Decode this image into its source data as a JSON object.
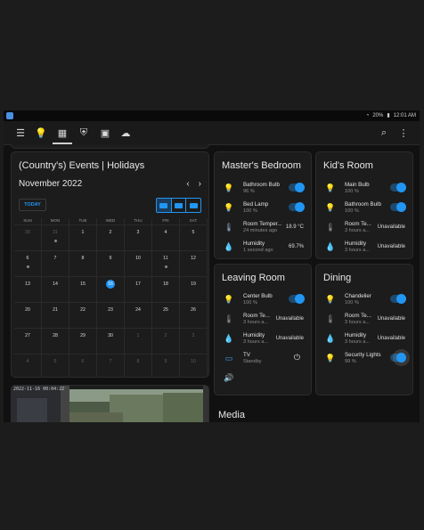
{
  "status_bar": {
    "battery": "20%",
    "time": "12:01 AM"
  },
  "toolbar": {
    "icons": [
      "menu-icon",
      "bulb-icon",
      "dashboard-icon",
      "shield-icon",
      "device-icon",
      "cloud-icon",
      "search-icon",
      "more-icon"
    ]
  },
  "calendar": {
    "title": "(Country's) Events | Holidays",
    "month": "November 2022",
    "today_label": "TODAY",
    "dow": [
      "SUN",
      "MON",
      "TUE",
      "WED",
      "THU",
      "FRI",
      "SAT"
    ],
    "weeks": [
      [
        {
          "d": "30",
          "o": true
        },
        {
          "d": "31",
          "o": true,
          "dot": true
        },
        {
          "d": "1"
        },
        {
          "d": "2"
        },
        {
          "d": "3"
        },
        {
          "d": "4"
        },
        {
          "d": "5"
        }
      ],
      [
        {
          "d": "6",
          "dot": true
        },
        {
          "d": "7"
        },
        {
          "d": "8"
        },
        {
          "d": "9"
        },
        {
          "d": "10"
        },
        {
          "d": "11",
          "dot": true
        },
        {
          "d": "12"
        }
      ],
      [
        {
          "d": "13"
        },
        {
          "d": "14"
        },
        {
          "d": "15"
        },
        {
          "d": "16",
          "today": true
        },
        {
          "d": "17"
        },
        {
          "d": "18"
        },
        {
          "d": "19"
        }
      ],
      [
        {
          "d": "20"
        },
        {
          "d": "21"
        },
        {
          "d": "22"
        },
        {
          "d": "23"
        },
        {
          "d": "24"
        },
        {
          "d": "25"
        },
        {
          "d": "26"
        }
      ],
      [
        {
          "d": "27"
        },
        {
          "d": "28"
        },
        {
          "d": "29"
        },
        {
          "d": "30"
        },
        {
          "d": "1",
          "o": true
        },
        {
          "d": "2",
          "o": true
        },
        {
          "d": "3",
          "o": true
        }
      ],
      [
        {
          "d": "4",
          "o": true
        },
        {
          "d": "5",
          "o": true
        },
        {
          "d": "6",
          "o": true
        },
        {
          "d": "7",
          "o": true
        },
        {
          "d": "8",
          "o": true
        },
        {
          "d": "9",
          "o": true
        },
        {
          "d": "10",
          "o": true
        }
      ]
    ]
  },
  "camera": {
    "timestamp": "2022-11-16 00:04:22"
  },
  "master_bedroom": {
    "title": "Master's Bedroom",
    "rows": [
      {
        "name": "Bathroom Bulb",
        "sub": "96 %"
      },
      {
        "name": "Bed Lamp",
        "sub": "100 %"
      },
      {
        "name": "Room Temper...",
        "sub": "24 minutes ago",
        "value": "18.9 °C"
      },
      {
        "name": "Humidity",
        "sub": "1 second ago",
        "value": "69.7%"
      }
    ]
  },
  "kids_room": {
    "title": "Kid's Room",
    "rows": [
      {
        "name": "Main Bulb",
        "sub": "100 %"
      },
      {
        "name": "Bathroom Bulb",
        "sub": "100 %"
      },
      {
        "name": "Room Te...",
        "sub": "3 hours a...",
        "value": "Unavailable"
      },
      {
        "name": "Humidity",
        "sub": "3 hours a...",
        "value": "Unavailable"
      }
    ]
  },
  "leaving_room": {
    "title": "Leaving Room",
    "rows": [
      {
        "name": "Center Bulb",
        "sub": "100 %"
      },
      {
        "name": "Room Te...",
        "sub": "3 hours a...",
        "value": "Unavailable"
      },
      {
        "name": "Humidity",
        "sub": "3 hours a...",
        "value": "Unavailable"
      },
      {
        "name": "TV",
        "sub": "Standby"
      }
    ]
  },
  "dining": {
    "title": "Dining",
    "rows": [
      {
        "name": "Chandelier",
        "sub": "100 %"
      },
      {
        "name": "Room Te...",
        "sub": "3 hours a...",
        "value": "Unavailable"
      },
      {
        "name": "Humidity",
        "sub": "3 hours a...",
        "value": "Unavailable"
      },
      {
        "name": "Security Lights",
        "sub": "99 %"
      }
    ]
  },
  "media": {
    "title": "Media"
  }
}
